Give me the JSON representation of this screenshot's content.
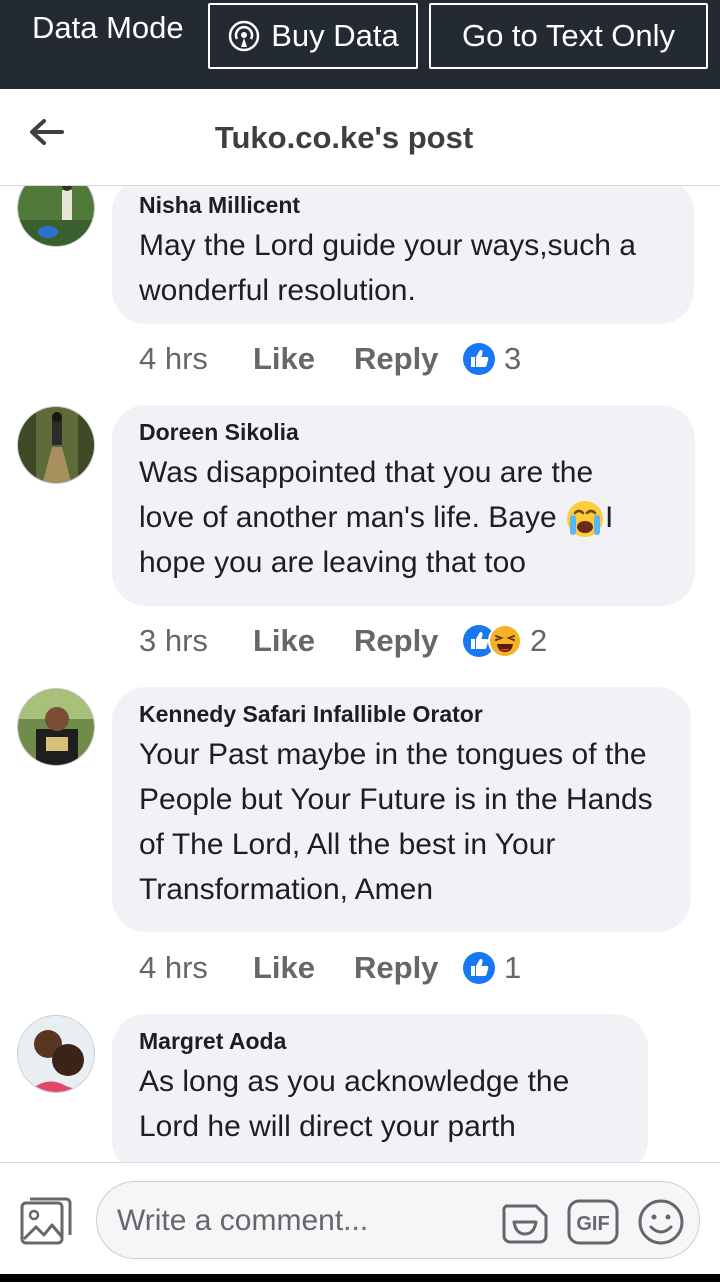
{
  "topbar": {
    "mode_label": "Data Mode",
    "buy_data_label": "Buy Data",
    "text_only_label": "Go to Text Only"
  },
  "header": {
    "title": "Tuko.co.ke's post"
  },
  "comments": [
    {
      "name": "Nisha Millicent",
      "text": "May the Lord guide your ways,such a wonderful resolution.",
      "time": "4 hrs",
      "like": "Like",
      "reply": "Reply",
      "reactions": [
        "like"
      ],
      "count": "3"
    },
    {
      "name": "Doreen Sikolia",
      "text_line1": "Was disappointed that you are the",
      "text_line2a": "love of another man's life. Baye ",
      "text_line2b": "I",
      "text_line3": "hope you are leaving that too",
      "time": "3 hrs",
      "like": "Like",
      "reply": "Reply",
      "reactions": [
        "like",
        "haha"
      ],
      "count": "2"
    },
    {
      "name": "Kennedy Safari Infallible Orator",
      "text": "Your Past maybe in the tongues of the People but Your Future is in the Hands of The Lord, All the best in Your Transformation, Amen",
      "time": "4 hrs",
      "like": "Like",
      "reply": "Reply",
      "reactions": [
        "like"
      ],
      "count": "1"
    },
    {
      "name": "Margret Aoda",
      "text": "As long as you acknowledge the Lord he will direct your parth"
    }
  ],
  "composer": {
    "placeholder": "Write a comment...",
    "gif_label": "GIF"
  },
  "colors": {
    "topbar_bg": "#232a33",
    "bubble_bg": "#f0f2f5",
    "like_blue": "#1877f2",
    "meta_gray": "#65676b"
  }
}
